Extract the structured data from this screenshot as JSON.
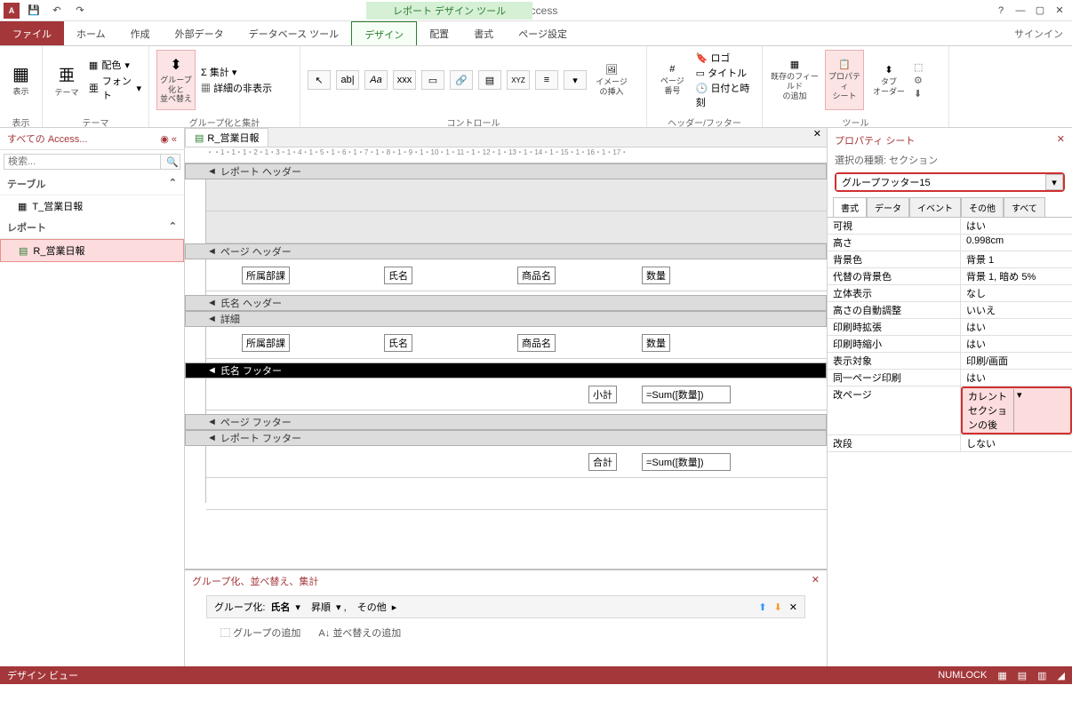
{
  "title": "Access",
  "context_title": "レポート デザイン ツール",
  "signin": "サインイン",
  "menu": {
    "file": "ファイル",
    "home": "ホーム",
    "create": "作成",
    "external": "外部データ",
    "dbtools": "データベース ツール",
    "design": "デザイン",
    "arrange": "配置",
    "format": "書式",
    "page": "ページ設定"
  },
  "ribbon": {
    "view": {
      "label": "表示",
      "btn": "表示"
    },
    "theme": {
      "label": "テーマ",
      "btn": "テーマ",
      "colors": "配色",
      "fonts": "フォント"
    },
    "group": {
      "label": "グループ化と集計",
      "groupsort": "グループ化と\n並べ替え",
      "totals": "集計",
      "hide": "詳細の非表示"
    },
    "controls": {
      "label": "コントロール",
      "image": "イメージ\nの挿入"
    },
    "hf": {
      "label": "ヘッダー/フッター",
      "page_no": "ページ\n番号",
      "logo": "ロゴ",
      "title": "タイトル",
      "datetime": "日付と時刻"
    },
    "tools": {
      "label": "ツール",
      "fields": "既存のフィールド\nの追加",
      "prop": "プロパティ\nシート",
      "tab": "タブ\nオーダー"
    }
  },
  "nav": {
    "header": "すべての Access...",
    "search_ph": "検索...",
    "tables": "テーブル",
    "reports": "レポート",
    "t_item": "T_営業日報",
    "r_item": "R_営業日報"
  },
  "doc": {
    "tab": "R_営業日報"
  },
  "sections": {
    "report_header": "レポート ヘッダー",
    "page_header": "ページ ヘッダー",
    "name_header": "氏名 ヘッダー",
    "detail": "詳細",
    "name_footer": "氏名 フッター",
    "page_footer": "ページ フッター",
    "report_footer": "レポート フッター"
  },
  "fields": {
    "dept": "所属部課",
    "name": "氏名",
    "product": "商品名",
    "qty": "数量",
    "subtotal": "小計",
    "total": "合計",
    "sum": "=Sum([数量])"
  },
  "group_pane": {
    "title": "グループ化、並べ替え、集計",
    "row_label": "グループ化:",
    "row_field": "氏名",
    "order": "昇順",
    "more": "その他",
    "add_group": "グループの追加",
    "add_sort": "並べ替えの追加"
  },
  "prop": {
    "title": "プロパティ シート",
    "sel_type": "選択の種類: セクション",
    "combo": "グループフッター15",
    "tabs": {
      "format": "書式",
      "data": "データ",
      "event": "イベント",
      "other": "その他",
      "all": "すべて"
    },
    "rows": [
      {
        "n": "可視",
        "v": "はい"
      },
      {
        "n": "高さ",
        "v": "0.998cm"
      },
      {
        "n": "背景色",
        "v": "背景 1"
      },
      {
        "n": "代替の背景色",
        "v": "背景 1, 暗め 5%"
      },
      {
        "n": "立体表示",
        "v": "なし"
      },
      {
        "n": "高さの自動調整",
        "v": "いいえ"
      },
      {
        "n": "印刷時拡張",
        "v": "はい"
      },
      {
        "n": "印刷時縮小",
        "v": "はい"
      },
      {
        "n": "表示対象",
        "v": "印刷/画面"
      },
      {
        "n": "同一ページ印刷",
        "v": "はい"
      },
      {
        "n": "改ページ",
        "v": "カレント セクションの後",
        "hl": true
      },
      {
        "n": "改段",
        "v": "しない"
      }
    ]
  },
  "status": {
    "left": "デザイン ビュー",
    "numlock": "NUMLOCK"
  },
  "ruler": "・・1・1・1・2・1・3・1・4・1・5・1・6・1・7・1・8・1・9・1・10・1・11・1・12・1・13・1・14・1・15・1・16・1・17・"
}
